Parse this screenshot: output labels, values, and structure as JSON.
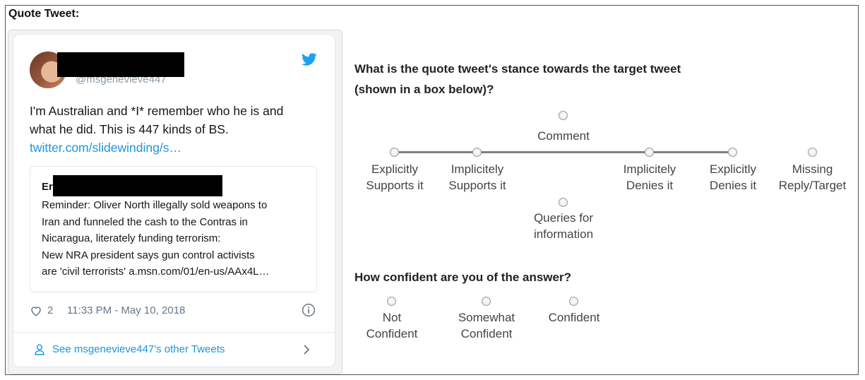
{
  "page": {
    "section_title": "Quote Tweet:"
  },
  "tweet": {
    "handle": "@msgenevieve447",
    "text_line1": "I'm Australian and *I* remember who he is and",
    "text_line2": "what he did.   This is 447 kinds of BS.",
    "link": "twitter.com/slidewinding/s…",
    "quoted": {
      "author_initial": "Er",
      "lines": [
        "Reminder: Oliver North illegally sold weapons to",
        "Iran and funneled the cash to the Contras in",
        "Nicaragua, literately funding terrorism:",
        "New NRA president says gun control activists",
        "are 'civil terrorists' a.msn.com/01/en-us/AAx4L…"
      ]
    },
    "likes": "2",
    "timestamp": "11:33 PM - May 10, 2018",
    "see_more": "See msgenevieve447's other Tweets"
  },
  "stance": {
    "question_line1": "What is the quote tweet's stance towards the target tweet",
    "question_line2": "(shown in a box below)?",
    "options": {
      "comment": "Comment",
      "explicitly_supports": [
        "Explicitly",
        "Supports it"
      ],
      "implicitly_supports": [
        "Implicitely",
        "Supports it"
      ],
      "implicitly_denies": [
        "Implicitely",
        "Denies it"
      ],
      "explicitly_denies": [
        "Explicitly",
        "Denies it"
      ],
      "missing": [
        "Missing",
        "Reply/Target"
      ],
      "queries": [
        "Queries for",
        "information"
      ]
    }
  },
  "confidence": {
    "question": "How confident are you of the answer?",
    "options": {
      "not_confident": [
        "Not",
        "Confident"
      ],
      "somewhat_confident": [
        "Somewhat",
        "Confident"
      ],
      "confident": "Confident"
    }
  },
  "colors": {
    "twitter_blue": "#1b95e0",
    "scale_line": "#808080"
  }
}
